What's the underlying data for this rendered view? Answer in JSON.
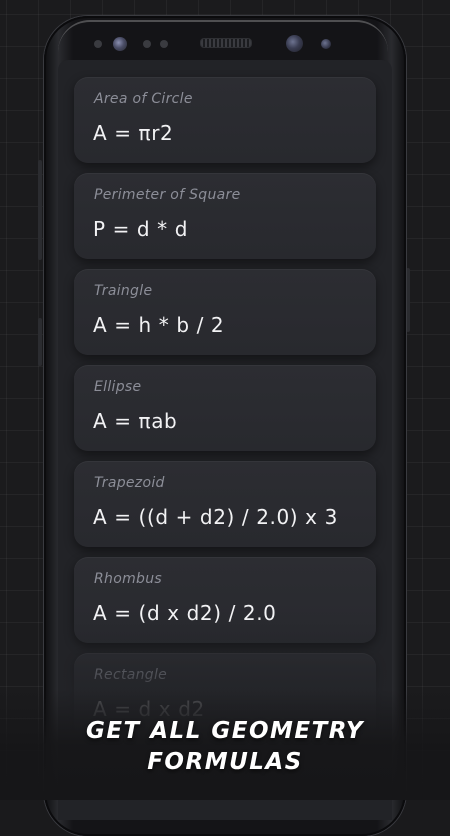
{
  "colors": {
    "background": "#1b1b1d",
    "screen": "#222327",
    "card": "#2b2c31",
    "card_title": "#8c8e98",
    "formula_text": "#f2f2f4",
    "promo_text": "#ffffff"
  },
  "formulas": [
    {
      "title": "Area of Circle",
      "formula": "A = πr2"
    },
    {
      "title": "Perimeter of Square",
      "formula": "P = d * d"
    },
    {
      "title": "Traingle",
      "formula": "A = h * b / 2"
    },
    {
      "title": "Ellipse",
      "formula": "A = πab"
    },
    {
      "title": "Trapezoid",
      "formula": "A = ((d + d2) / 2.0) x 3"
    },
    {
      "title": "Rhombus",
      "formula": "A = (d x d2) / 2.0"
    },
    {
      "title": "Rectangle",
      "formula": "A = d x d2"
    }
  ],
  "promo": {
    "line1": "GET ALL GEOMETRY",
    "line2": "FORMULAS"
  }
}
